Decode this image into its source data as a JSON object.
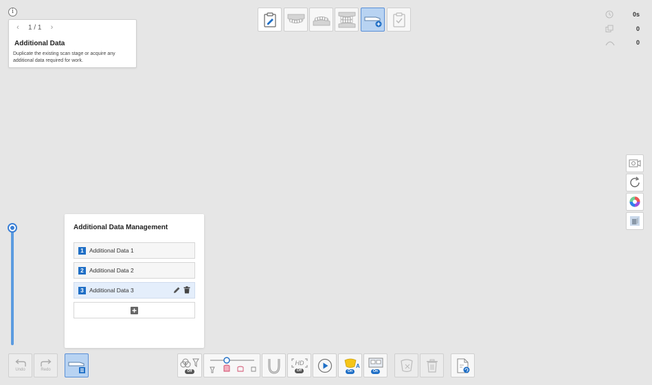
{
  "guide": {
    "info_icon": "i",
    "page": "1 / 1",
    "title": "Additional Data",
    "description": "Duplicate the existing scan stage or acquire any additional data required for work."
  },
  "stages": [
    {
      "name": "edit-stage",
      "icon": "clipboard-pencil-icon"
    },
    {
      "name": "maxilla-stage",
      "icon": "maxilla-icon"
    },
    {
      "name": "mandible-stage",
      "icon": "mandible-icon"
    },
    {
      "name": "occlusion-stage",
      "icon": "occlusion-icon"
    },
    {
      "name": "additional-data-stage",
      "icon": "scanner-plus-icon",
      "active": true
    },
    {
      "name": "complete-stage",
      "icon": "clipboard-check-icon"
    }
  ],
  "status": {
    "time": "0s",
    "count": "0",
    "accuracy": "0"
  },
  "panel": {
    "title": "Additional Data Management",
    "items": [
      {
        "num": "1",
        "label": "Additional Data 1"
      },
      {
        "num": "2",
        "label": "Additional Data 2"
      },
      {
        "num": "3",
        "label": "Additional Data 3",
        "selected": true
      }
    ]
  },
  "bottom": {
    "undo": "Undo",
    "redo": "Redo",
    "filter_state": "Off",
    "hd_state": "Off",
    "ai_state": "On",
    "smart_state": "On"
  },
  "colors": {
    "accent": "#1f6fc6",
    "active_bg": "#b8d3f2",
    "slider": "#5b9be0"
  }
}
